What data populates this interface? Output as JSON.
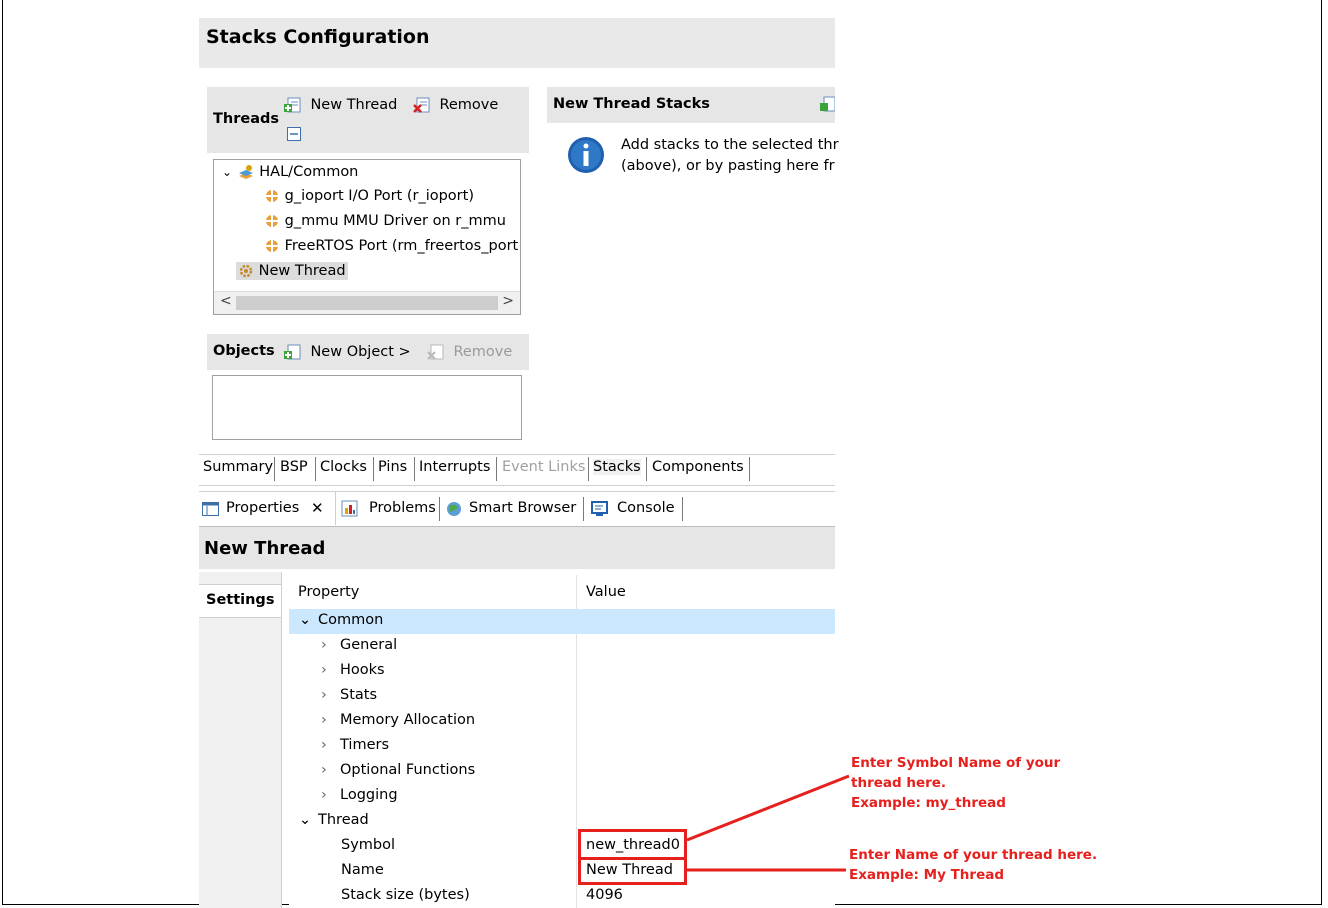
{
  "header": {
    "title": "Stacks Configuration"
  },
  "threads_panel": {
    "label": "Threads",
    "new_thread": "New Thread",
    "remove": "Remove",
    "tree": {
      "root": "HAL/Common",
      "items": [
        "g_ioport I/O Port (r_ioport)",
        "g_mmu MMU Driver on r_mmu",
        "FreeRTOS Port (rm_freertos_port"
      ],
      "selected": "New Thread"
    }
  },
  "new_thread_stacks": {
    "title": "New Thread Stacks",
    "info_line1": "Add stacks to the selected thr",
    "info_line2": "(above), or by pasting here fr"
  },
  "objects_panel": {
    "label": "Objects",
    "new_object": "New Object >",
    "remove": "Remove"
  },
  "config_tabs": [
    "Summary",
    "BSP",
    "Clocks",
    "Pins",
    "Interrupts",
    "Event Links",
    "Stacks",
    "Components"
  ],
  "view_tabs": {
    "properties": "Properties",
    "problems": "Problems",
    "smart_browser": "Smart Browser",
    "console": "Console"
  },
  "properties": {
    "title": "New Thread",
    "settings_tab": "Settings",
    "col_property": "Property",
    "col_value": "Value",
    "common": "Common",
    "common_items": [
      "General",
      "Hooks",
      "Stats",
      "Memory Allocation",
      "Timers",
      "Optional Functions",
      "Logging"
    ],
    "thread": "Thread",
    "symbol_label": "Symbol",
    "symbol_value": "new_thread0",
    "name_label": "Name",
    "name_value": "New Thread",
    "stack_label": "Stack size (bytes)",
    "stack_value": "4096"
  },
  "annotations": {
    "symbol_line1": "Enter Symbol Name of your",
    "symbol_line2": "thread here.",
    "symbol_line3": "Example: my_thread",
    "name_line1": "Enter Name of your thread here.",
    "name_line2": "Example: My Thread"
  },
  "colors": {
    "annotation_red": "#e5201d",
    "selected_row": "#cce8ff",
    "panel_gray": "#e6e6e6"
  }
}
